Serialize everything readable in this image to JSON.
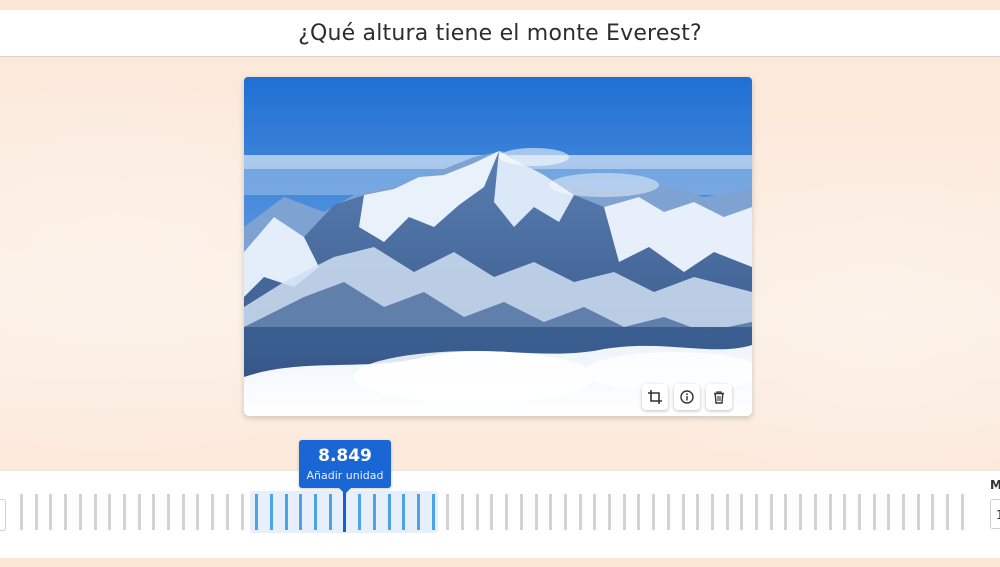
{
  "question": {
    "title": "¿Qué altura tiene el monte Everest?"
  },
  "image": {
    "alt": "monte Everest",
    "actions": [
      {
        "name": "crop",
        "icon": "crop-icon"
      },
      {
        "name": "info",
        "icon": "info-icon"
      },
      {
        "name": "delete",
        "icon": "trash-icon"
      }
    ]
  },
  "slider": {
    "value_label": "8.849",
    "unit_button_label": "Añadir unidad",
    "right_label_partial": "M",
    "right_value_partial": "1",
    "accent_color": "#1a66d4"
  }
}
